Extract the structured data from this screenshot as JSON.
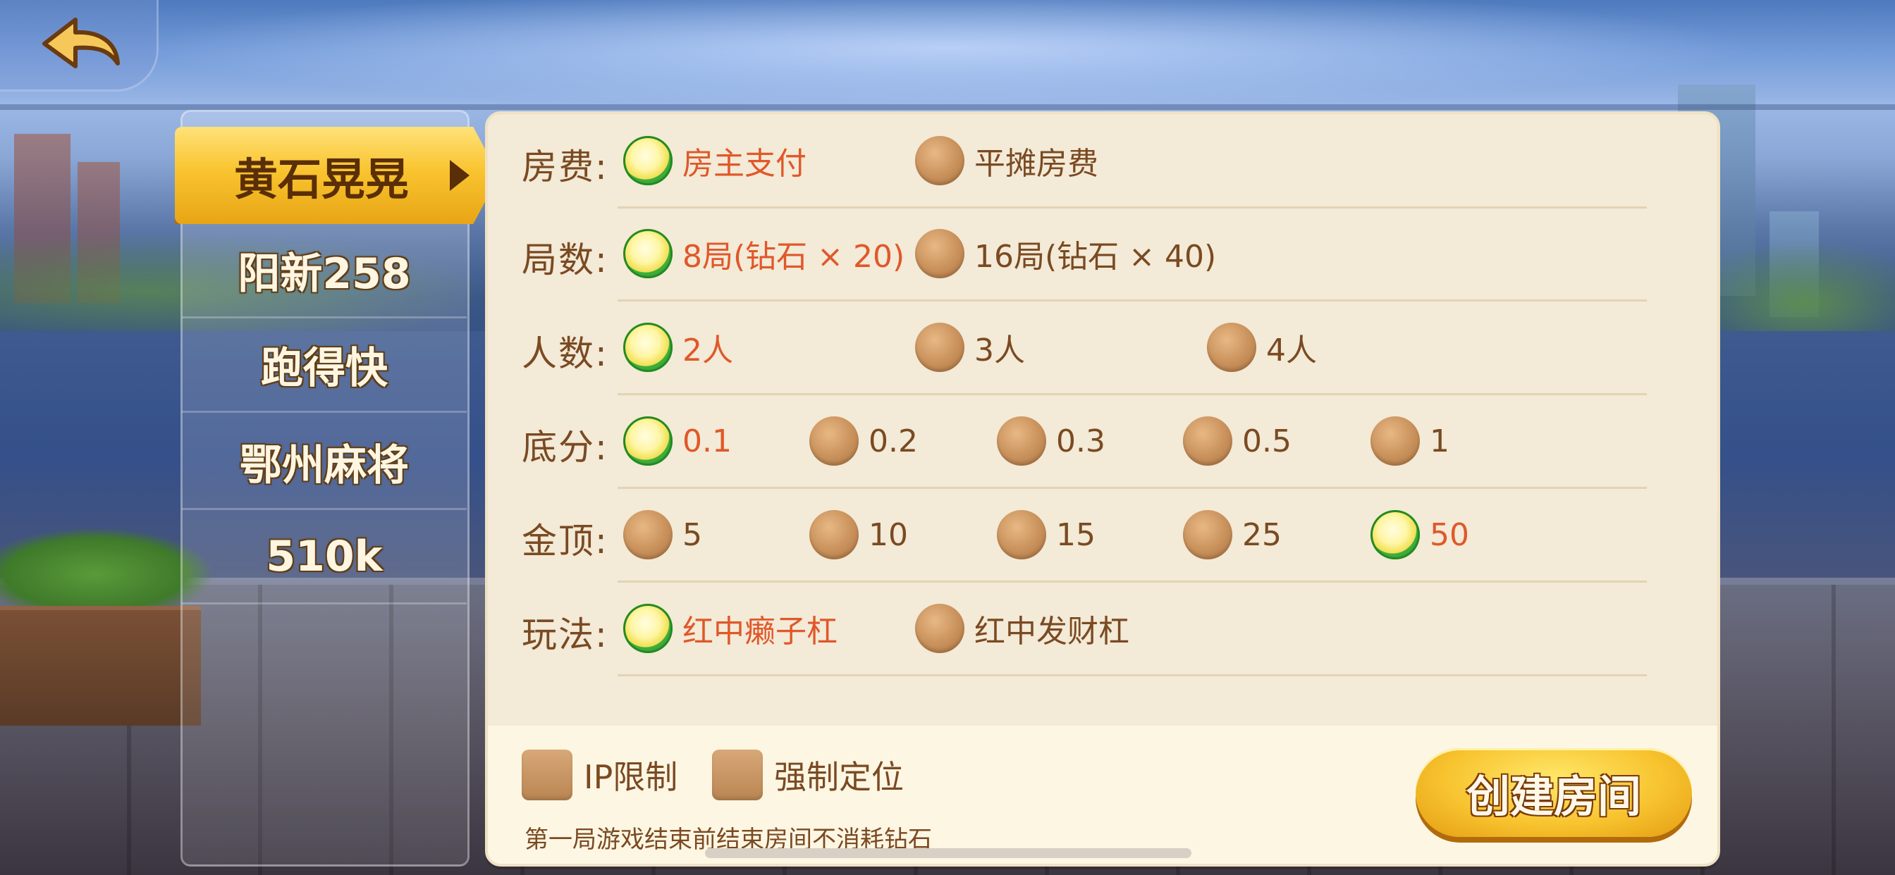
{
  "nav": {
    "back_icon": "back-arrow-icon",
    "tabs": [
      {
        "label": "黄石晃晃",
        "active": true
      },
      {
        "label": "阳新258",
        "active": false
      },
      {
        "label": "跑得快",
        "active": false
      },
      {
        "label": "鄂州麻将",
        "active": false
      },
      {
        "label": "510k",
        "active": false
      }
    ]
  },
  "settings": {
    "rows": [
      {
        "label": "房费:",
        "options": [
          {
            "text": "房主支付",
            "selected": true
          },
          {
            "text": "平摊房费",
            "selected": false
          }
        ]
      },
      {
        "label": "局数:",
        "options": [
          {
            "text": "8局(钻石 × 20)",
            "selected": true
          },
          {
            "text": "16局(钻石 × 40)",
            "selected": false
          }
        ]
      },
      {
        "label": "人数:",
        "options": [
          {
            "text": "2人",
            "selected": true
          },
          {
            "text": "3人",
            "selected": false
          },
          {
            "text": "4人",
            "selected": false
          }
        ]
      },
      {
        "label": "底分:",
        "options": [
          {
            "text": "0.1",
            "selected": true
          },
          {
            "text": "0.2",
            "selected": false
          },
          {
            "text": "0.3",
            "selected": false
          },
          {
            "text": "0.5",
            "selected": false
          },
          {
            "text": "1",
            "selected": false
          }
        ]
      },
      {
        "label": "金顶:",
        "options": [
          {
            "text": "5",
            "selected": false
          },
          {
            "text": "10",
            "selected": false
          },
          {
            "text": "15",
            "selected": false
          },
          {
            "text": "25",
            "selected": false
          },
          {
            "text": "50",
            "selected": true
          }
        ]
      },
      {
        "label": "玩法:",
        "options": [
          {
            "text": "红中癞子杠",
            "selected": true
          },
          {
            "text": "红中发财杠",
            "selected": false
          }
        ]
      }
    ]
  },
  "footer": {
    "checkboxes": [
      {
        "label": "IP限制",
        "checked": false
      },
      {
        "label": "强制定位",
        "checked": false
      }
    ],
    "note": "第一局游戏结束前结束房间不消耗钻石",
    "create_label": "创建房间"
  },
  "colors": {
    "selected_text": "#e0582a",
    "normal_text": "#7a4a22",
    "panel_bg": "#f3ead7",
    "button_gold": "#f8c430"
  }
}
